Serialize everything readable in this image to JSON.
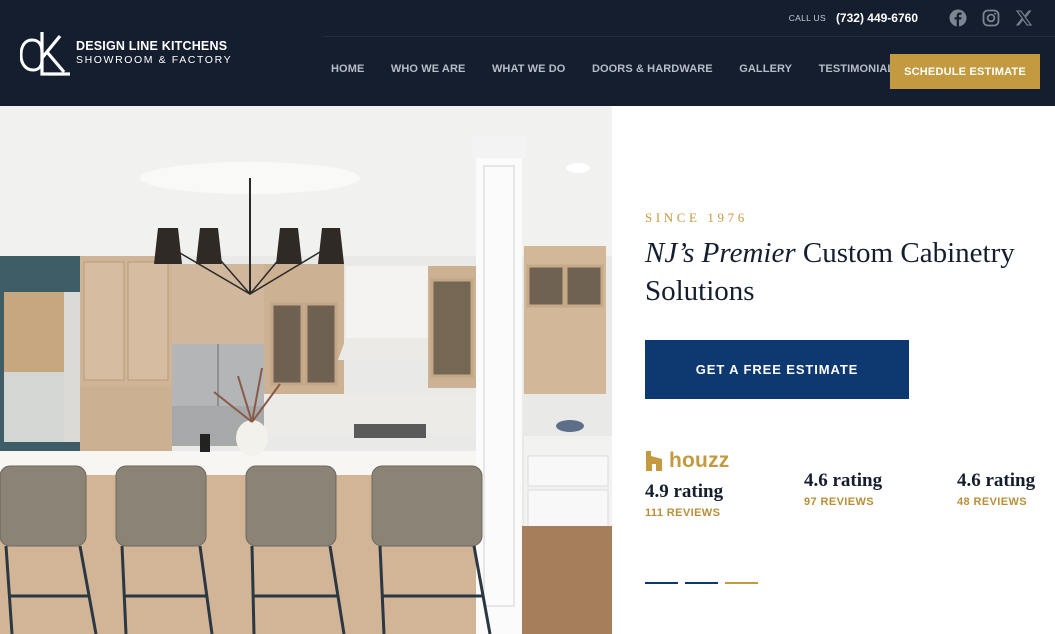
{
  "brand": {
    "name": "DESIGN LINE KITCHENS",
    "subtitle": "SHOWROOM & FACTORY"
  },
  "topbar": {
    "call_label": "CALL US",
    "phone": "(732) 449-6760",
    "social": [
      "facebook-icon",
      "instagram-icon",
      "x-icon"
    ]
  },
  "nav": {
    "items": [
      {
        "label": "HOME"
      },
      {
        "label": "WHO WE ARE"
      },
      {
        "label": "WHAT WE DO"
      },
      {
        "label": "DOORS & HARDWARE"
      },
      {
        "label": "GALLERY"
      },
      {
        "label": "TESTIMONIALS"
      }
    ],
    "cta": "SCHEDULE ESTIMATE"
  },
  "hero": {
    "eyebrow": "SINCE 1976",
    "headline_italic": "NJ’s Premier",
    "headline_rest": " Custom Cabinetry Solutions",
    "cta": "GET A FREE ESTIMATE"
  },
  "reviews": {
    "source": "houzz",
    "ratings": [
      {
        "value": "4.9 rating",
        "count": "111 REVIEWS"
      },
      {
        "value": "4.6 rating",
        "count": "97 REVIEWS"
      },
      {
        "value": "4.6 rating",
        "count": "48 REVIEWS"
      }
    ]
  },
  "slider": {
    "slides": 3,
    "active_index": 2
  },
  "colors": {
    "header_bg": "#141e2e",
    "gold": "#c39a40",
    "navy": "#0e3870"
  }
}
